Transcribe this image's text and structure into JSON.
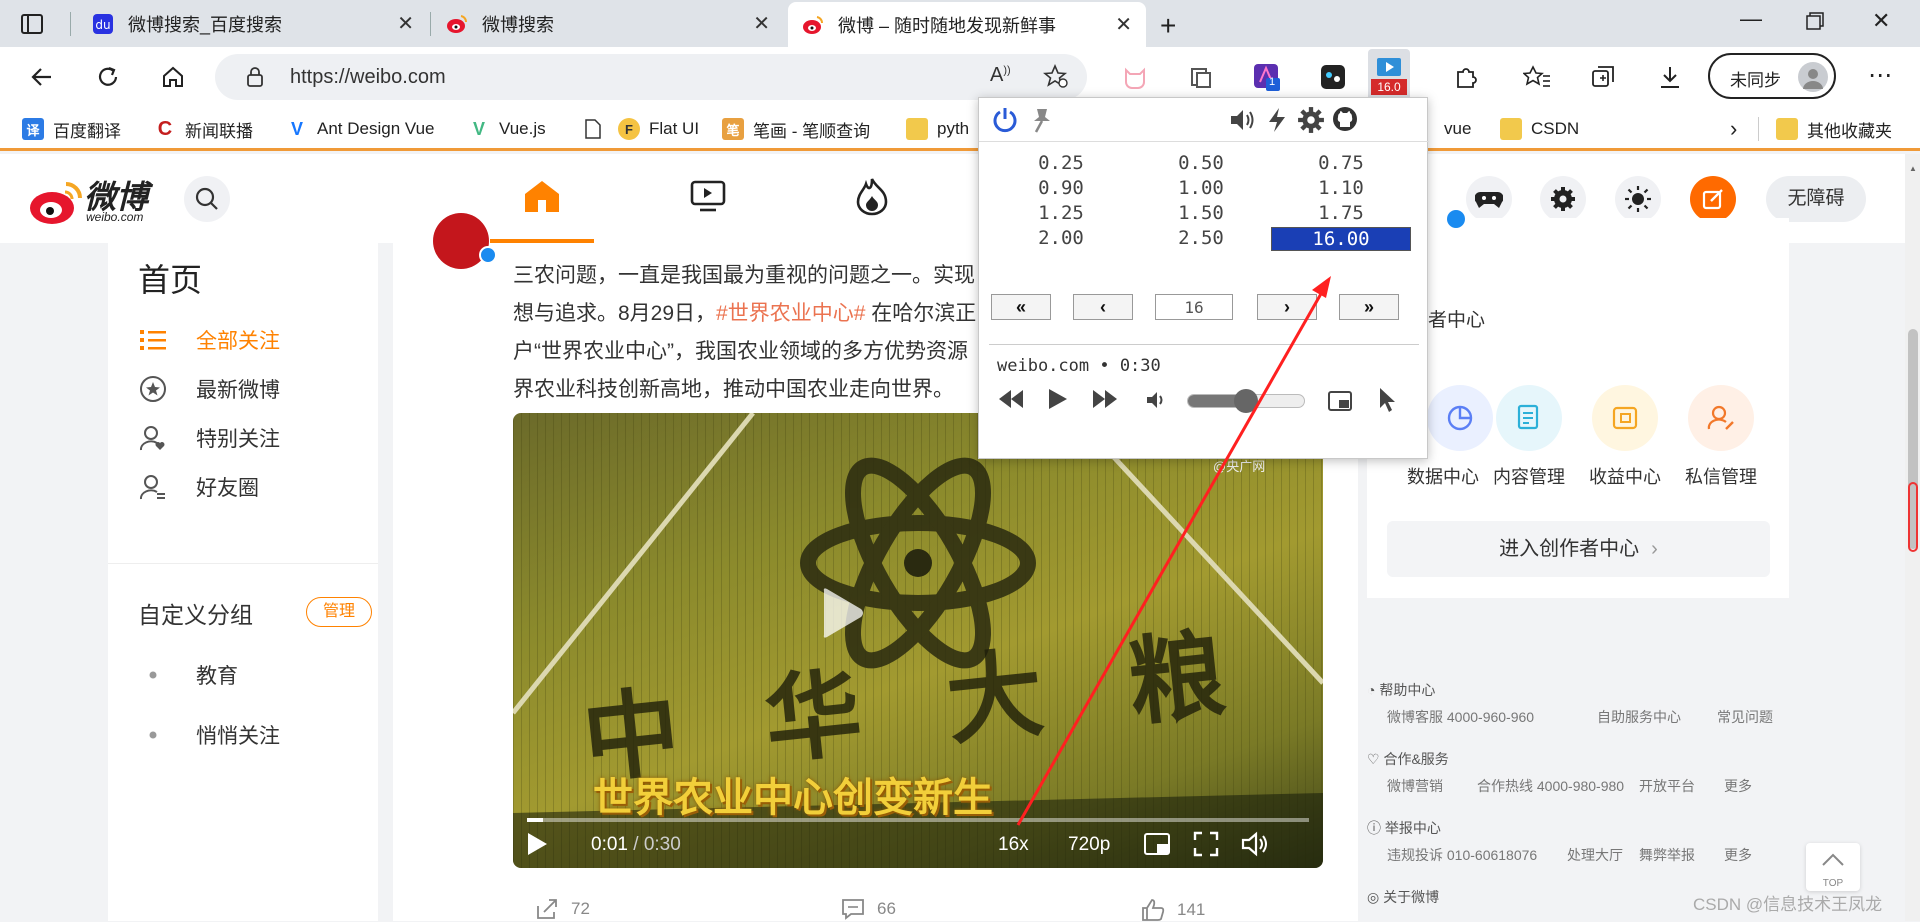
{
  "browser": {
    "tabs": [
      {
        "title": "微博搜索_百度搜索"
      },
      {
        "title": "微博搜索"
      },
      {
        "title": "微博 – 随时随地发现新鲜事"
      }
    ],
    "address": "https://weibo.com",
    "ext_badge_count": "1",
    "ext_speed_badge": "16.0",
    "sync_label": "未同步",
    "bookmarks": [
      {
        "label": "百度翻译",
        "icon": "译"
      },
      {
        "label": "新闻联播",
        "icon": "C"
      },
      {
        "label": "Ant Design Vue",
        "icon": "V"
      },
      {
        "label": "Vue.js",
        "icon": "V"
      },
      {
        "label": "Flat UI",
        "icon": "F"
      },
      {
        "label": "笔画 - 笔顺查询",
        "icon": "笔"
      },
      {
        "label": "pyth"
      },
      {
        "label": "vue"
      },
      {
        "label": "CSDN"
      },
      {
        "label": "其他收藏夹"
      }
    ]
  },
  "weibo": {
    "logo_cn": "微博",
    "logo_en": "weibo.com",
    "accessibility_label": "无障碍",
    "left_nav": {
      "title": "首页",
      "items": [
        "全部关注",
        "最新微博",
        "特别关注",
        "好友圈"
      ],
      "group_title": "自定义分组",
      "manage_label": "管理",
      "groups": [
        "教育",
        "悄悄关注"
      ]
    },
    "post": {
      "lines": [
        "三农问题，一直是我国最为重视的问题之一。实现",
        "想与追求。8月29日，",
        "户“世界农业中心”，我国农业领域的多方优势资源",
        "界农业科技创新高地，推动中国农业走向世界。"
      ],
      "hashtag": "#世界农业中心#",
      "line2_tail": " 在哈尔滨正",
      "video": {
        "watermark": "@央广网",
        "field_text": "中 华 大 粮",
        "caption": "世界农业中心创变新生",
        "time_current": "0:01",
        "time_total": "0:30",
        "speed": "16x",
        "quality": "720p",
        "progress": 0.02
      },
      "actions": {
        "share": "72",
        "comments": "66",
        "likes": "141"
      }
    },
    "creator": {
      "title": "作者中心",
      "items": [
        "数据中心",
        "内容管理",
        "收益中心",
        "私信管理"
      ],
      "enter_label": "进入创作者中心"
    },
    "footer": [
      {
        "title": "帮助中心",
        "links": [
          "微博客服 4000-960-960",
          "自助服务中心",
          "常见问题"
        ]
      },
      {
        "title": "合作&服务",
        "links": [
          "微博营销",
          "合作热线 4000-980-980",
          "开放平台",
          "更多"
        ]
      },
      {
        "title": "举报中心",
        "links": [
          "违规投诉 010-60618076",
          "处理大厅",
          "舞弊举报",
          "更多"
        ]
      },
      {
        "title": "关于微博"
      }
    ],
    "top_label": "TOP",
    "credit": "CSDN @信息技术王凤龙"
  },
  "speed_popup": {
    "speeds": [
      "0.25",
      "0.50",
      "0.75",
      "0.90",
      "1.00",
      "1.10",
      "1.25",
      "1.50",
      "1.75",
      "2.00",
      "2.50",
      "16.00"
    ],
    "selected": "16.00",
    "step_input": "16",
    "site_status": "weibo.com • 0:30",
    "volume_level": 0.5
  },
  "colors": {
    "accent": "#ff8200",
    "selected": "#1a3fb5",
    "arrow": "#ff2020"
  }
}
